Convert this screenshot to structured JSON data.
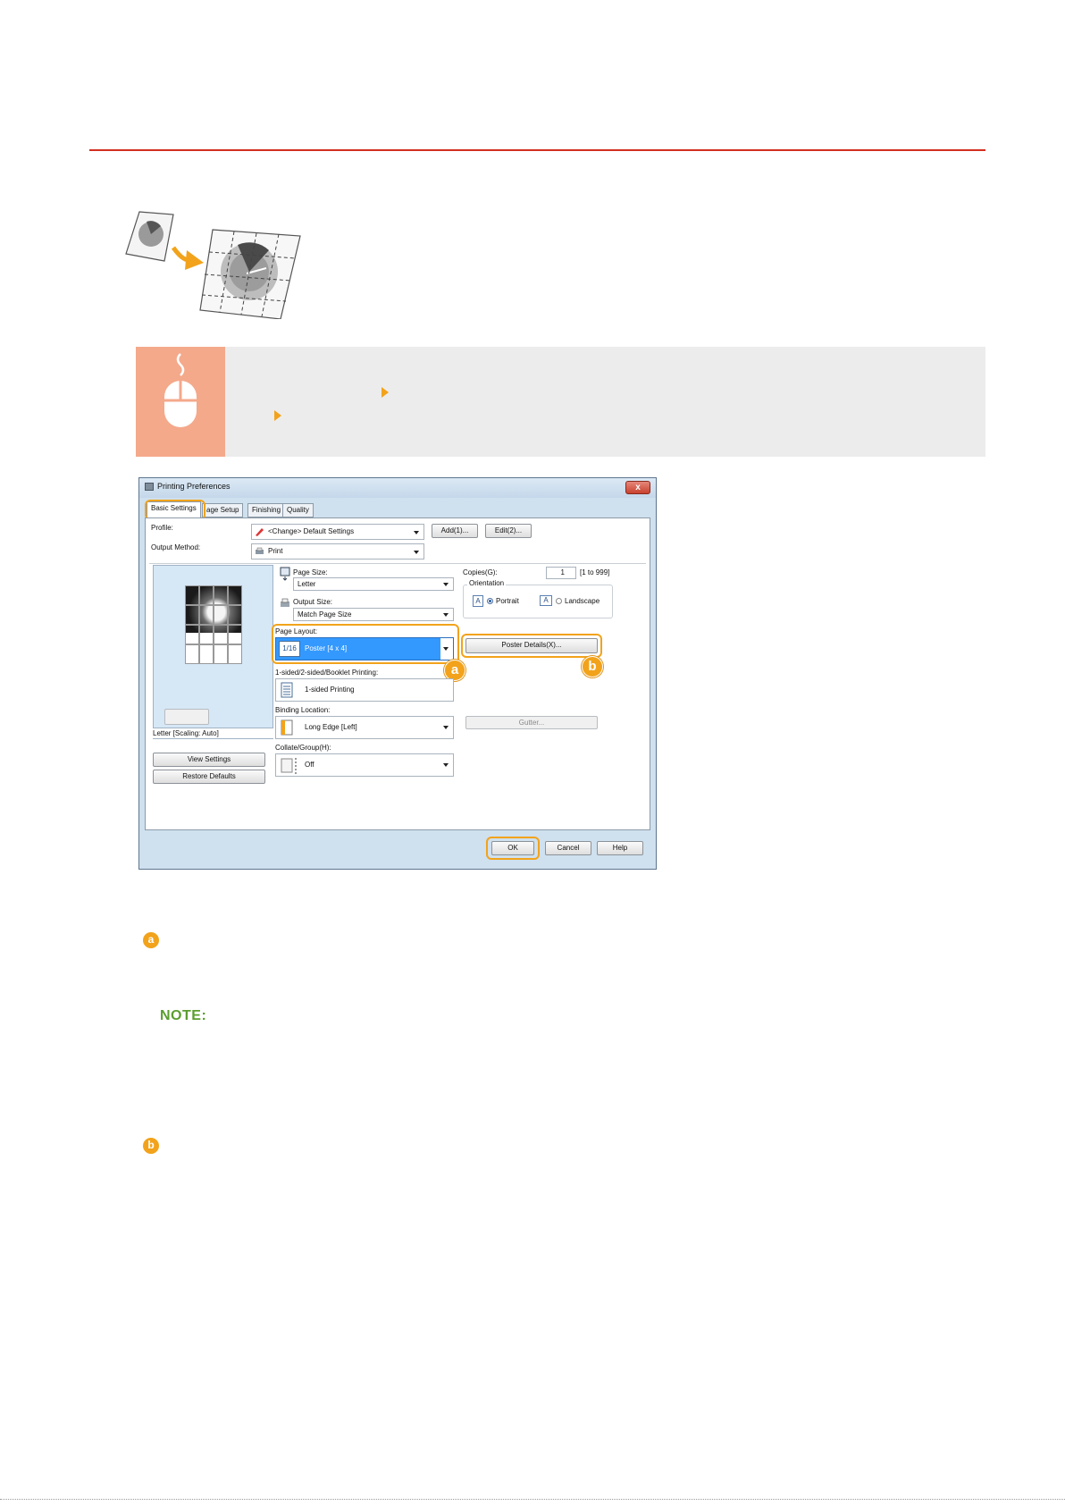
{
  "dialog": {
    "title": "Printing Preferences",
    "close_glyph": "x",
    "tabs": [
      {
        "label": "Basic Settings",
        "active": true
      },
      {
        "label": "age Setup",
        "active": false
      },
      {
        "label": "Finishing",
        "active": false
      },
      {
        "label": "Quality",
        "active": false
      }
    ],
    "profile": {
      "label": "Profile:",
      "value": "<Change> Default Settings",
      "add_button": "Add(1)...",
      "edit_button": "Edit(2)..."
    },
    "output_method": {
      "label": "Output Method:",
      "value": "Print"
    },
    "page_size": {
      "label": "Page Size:",
      "value": "Letter"
    },
    "output_size": {
      "label": "Output Size:",
      "value": "Match Page Size"
    },
    "copies": {
      "label": "Copies(G):",
      "value": "1",
      "range": "[1 to 999]"
    },
    "orientation": {
      "label": "Orientation",
      "portrait": "Portrait",
      "landscape": "Landscape",
      "icon_glyph": "A",
      "selected": "Portrait"
    },
    "page_layout": {
      "label": "Page Layout:",
      "value": "Poster [4 x 4]",
      "icon_text": "1/16",
      "details_button": "Poster Details(X)..."
    },
    "sided": {
      "label": "1-sided/2-sided/Booklet Printing:",
      "value": "1-sided Printing"
    },
    "binding": {
      "label": "Binding Location:",
      "value": "Long Edge [Left]",
      "gutter_button": "Gutter..."
    },
    "collate": {
      "label": "Collate/Group(H):",
      "value": "Off"
    },
    "preview": {
      "caption": "Letter [Scaling: Auto]",
      "view_settings": "View Settings",
      "restore_defaults": "Restore Defaults"
    },
    "footer_buttons": {
      "ok": "OK",
      "cancel": "Cancel",
      "help": "Help"
    }
  },
  "callouts": {
    "a": "a",
    "b": "b"
  },
  "note_label": "NOTE:",
  "colors": {
    "accent_orange": "#f2a31b",
    "rule_red": "#d32f1f",
    "banner_gray": "#ececec",
    "banner_icon_salmon": "#f4a98b",
    "selection_blue": "#3399ff",
    "note_green": "#5a9e2e"
  }
}
